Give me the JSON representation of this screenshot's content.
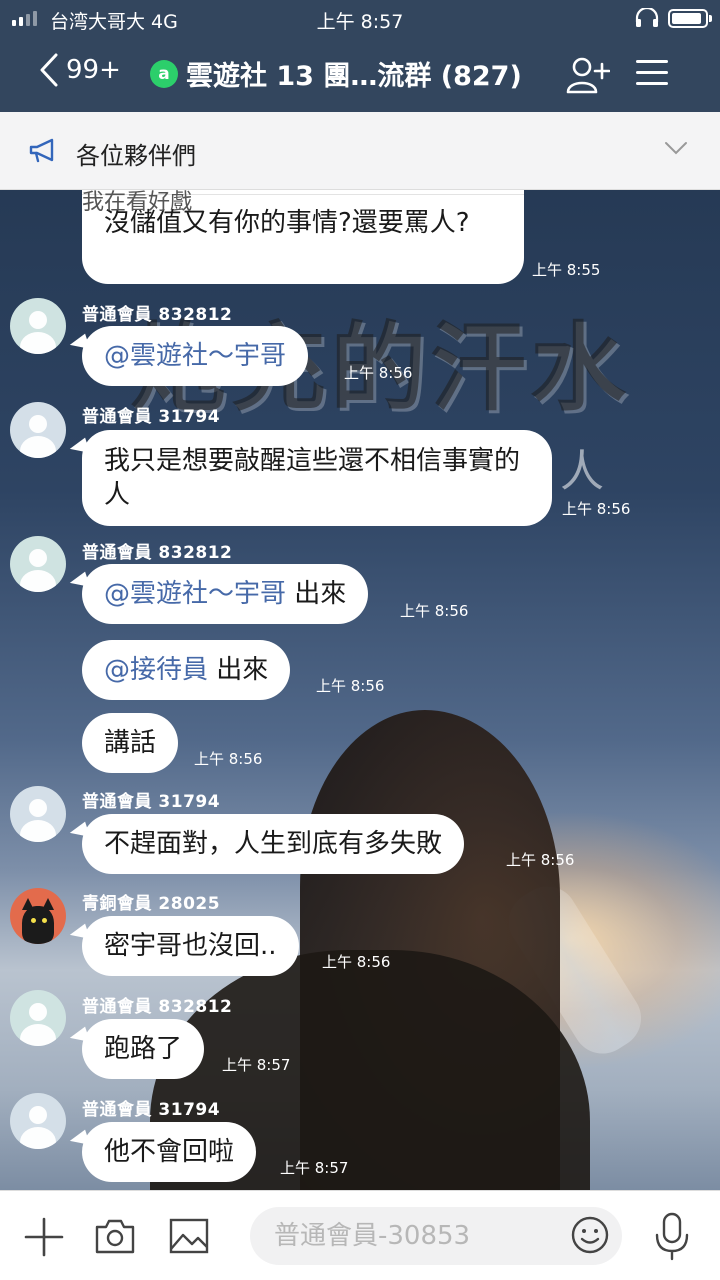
{
  "status_bar": {
    "carrier": "台湾大哥大  4G",
    "time": "上午 8:57",
    "battery_level": 0.9
  },
  "nav": {
    "back_count": "99+",
    "group_icon_letter": "a",
    "title": "雲遊社 13 團…流群 (827)"
  },
  "announcement": {
    "text": "各位夥伴們"
  },
  "background": {
    "wordmark": "炮充的汗水",
    "word_small": "人"
  },
  "messages": {
    "quoted_prev": "我在看好戲",
    "m0": {
      "text": "沒儲值又有你的事情?還要罵人?",
      "time": "上午 8:55"
    },
    "m1": {
      "sender": "普通會員 832812",
      "mention": "@雲遊社～宇哥",
      "text": "",
      "time": "上午 8:56"
    },
    "m2": {
      "sender": "普通會員 31794",
      "text": "我只是想要敲醒這些還不相信事實的人",
      "time": "上午 8:56"
    },
    "m3": {
      "sender": "普通會員 832812",
      "mention": "@雲遊社～宇哥",
      "text": " 出來",
      "time": "上午 8:56"
    },
    "m4": {
      "mention": "@接待員",
      "text": " 出來",
      "time": "上午 8:56"
    },
    "m5": {
      "text": "講話",
      "time": "上午 8:56"
    },
    "m6": {
      "sender": "普通會員 31794",
      "text": "不趕面對，人生到底有多失敗",
      "time": "上午 8:56"
    },
    "m7": {
      "sender": "青銅會員 28025",
      "text": "密宇哥也沒回..",
      "time": "上午 8:56"
    },
    "m8": {
      "sender": "普通會員 832812",
      "text": "跑路了",
      "time": "上午 8:57"
    },
    "m9": {
      "sender": "普通會員 31794",
      "text": "他不會回啦",
      "time": "上午 8:57"
    }
  },
  "input": {
    "placeholder": "普通會員-30853"
  },
  "colors": {
    "header": "#33465e",
    "mention": "#4669a8",
    "group_badge": "#2ccf6b"
  },
  "icons": [
    "back-chevron-icon",
    "add-friend-icon",
    "menu-icon",
    "megaphone-icon",
    "chevron-down-icon",
    "plus-icon",
    "camera-icon",
    "image-icon",
    "emoji-icon",
    "microphone-icon"
  ]
}
